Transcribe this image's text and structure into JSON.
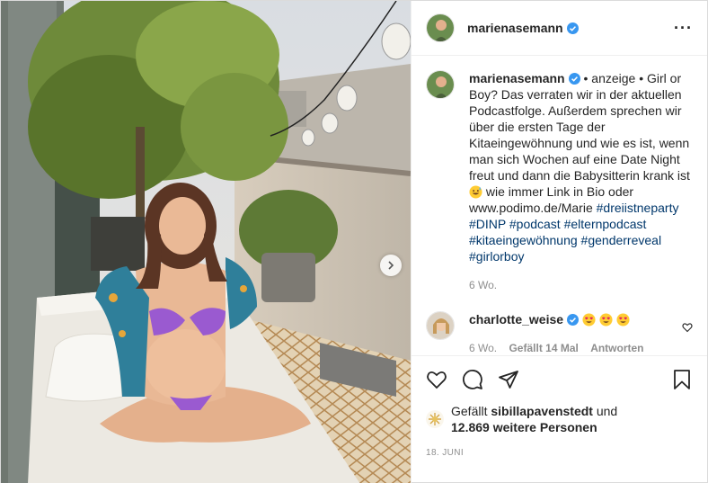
{
  "post": {
    "username": "marienasemann",
    "more_icon": "···",
    "image_alt": "Pregnant woman in purple bikini sitting on a balcony daybed"
  },
  "caption": {
    "username": "marienasemann",
    "text_before": " • anzeige • Girl or Boy? Das verraten wir in der aktuellen Podcastfolge. Außerdem sprechen wir über die ersten Tage der Kitaeingewöhnung und wie es ist, wenn man sich Wochen auf eine Date Night freut und dann die Babysitterin krank ist ",
    "emoji": "sweat-smile",
    "text_after": " wie immer Link in Bio oder www.podimo.de/Marie ",
    "hashtags": [
      "#dreiistneparty",
      "#DINP",
      "#podcast",
      "#elternpodcast",
      "#kitaeingewöhnung",
      "#genderreveal",
      "#girlorboy"
    ],
    "time": "6 Wo."
  },
  "comment": {
    "username": "charlotte_weise",
    "emojis": [
      "heart-eyes",
      "heart-eyes",
      "heart-eyes"
    ],
    "time": "6 Wo.",
    "likes": "Gefällt 14 Mal",
    "reply": "Antworten"
  },
  "likes": {
    "prefix": "Gefällt ",
    "user": "sibillapavenstedt",
    "middle": " und",
    "count_text": "12.869 weitere Personen"
  },
  "date": "18. JUNI",
  "colors": {
    "verified": "#3897f0",
    "hashtag": "#00376b",
    "muted": "#8e8e8e"
  }
}
